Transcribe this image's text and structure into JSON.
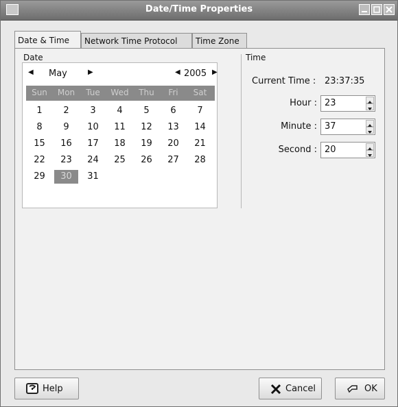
{
  "window": {
    "title": "Date/Time Properties"
  },
  "tabs": [
    {
      "label": "Date & Time"
    },
    {
      "label": "Network Time Protocol"
    },
    {
      "label": "Time Zone"
    }
  ],
  "date": {
    "section_label": "Date",
    "month": "May",
    "year": "2005",
    "day_names": [
      "Sun",
      "Mon",
      "Tue",
      "Wed",
      "Thu",
      "Fri",
      "Sat"
    ],
    "weeks": [
      [
        "1",
        "2",
        "3",
        "4",
        "5",
        "6",
        "7"
      ],
      [
        "8",
        "9",
        "10",
        "11",
        "12",
        "13",
        "14"
      ],
      [
        "15",
        "16",
        "17",
        "18",
        "19",
        "20",
        "21"
      ],
      [
        "22",
        "23",
        "24",
        "25",
        "26",
        "27",
        "28"
      ],
      [
        "29",
        "30",
        "31",
        "",
        "",
        "",
        ""
      ]
    ],
    "selected_day": "30"
  },
  "time": {
    "section_label": "Time",
    "current_time_label": "Current Time :",
    "current_time_value": "23:37:35",
    "hour_label": "Hour :",
    "hour_value": "23",
    "minute_label": "Minute :",
    "minute_value": "37",
    "second_label": "Second :",
    "second_value": "20"
  },
  "buttons": {
    "help": "Help",
    "cancel": "Cancel",
    "ok": "OK"
  }
}
